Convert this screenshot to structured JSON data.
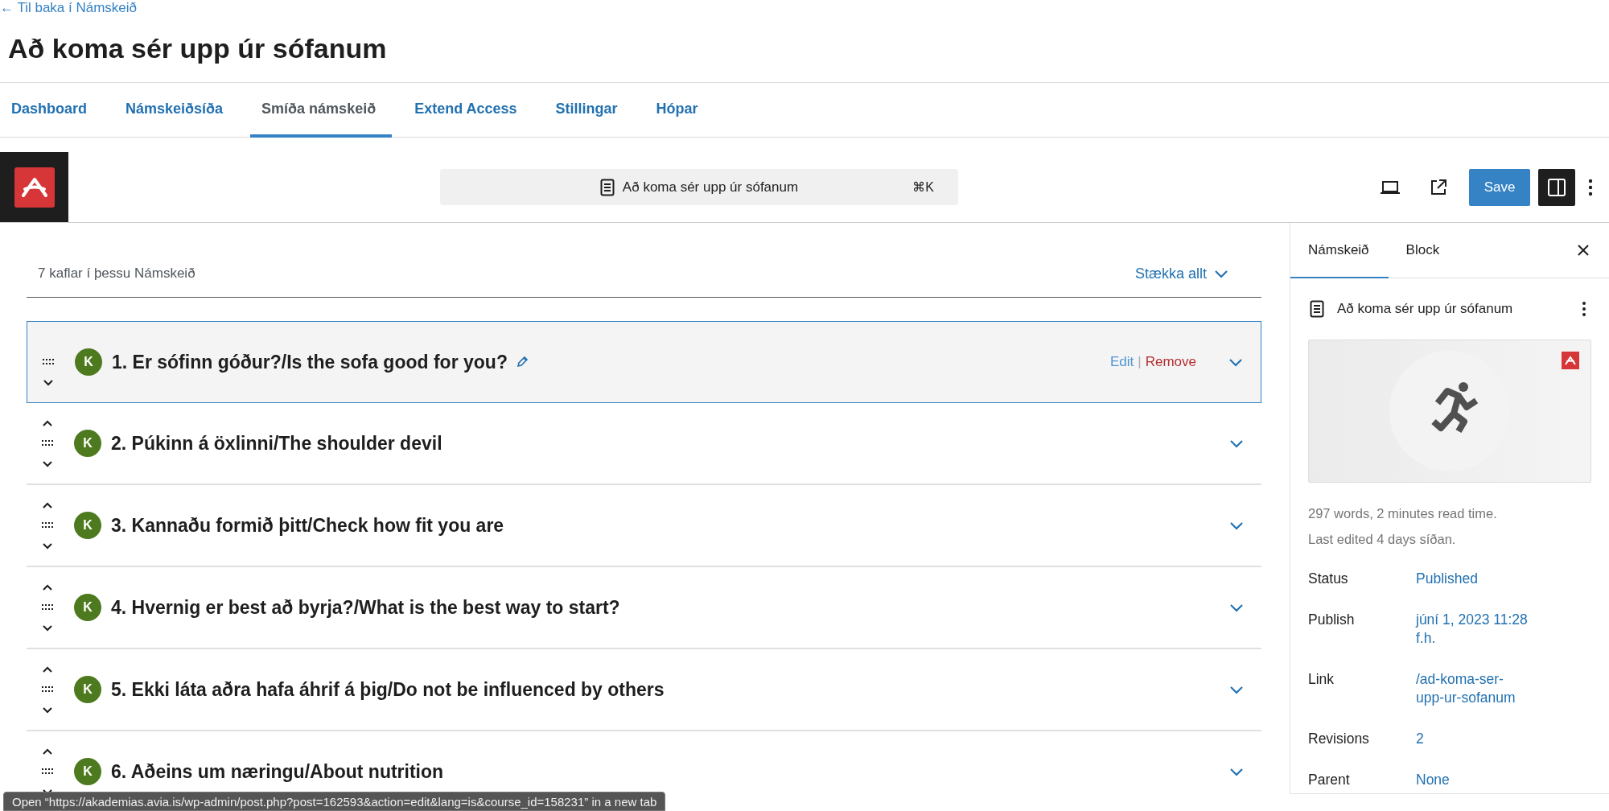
{
  "back_link": "← Til baka í Námskeið",
  "page_title": "Að koma sér upp úr sófanum",
  "tabs": [
    {
      "label": "Dashboard",
      "selected": false
    },
    {
      "label": "Námskeiðsíða",
      "selected": false
    },
    {
      "label": "Smíða námskeið",
      "selected": true
    },
    {
      "label": "Extend Access",
      "selected": false
    },
    {
      "label": "Stillingar",
      "selected": false
    },
    {
      "label": "Hópar",
      "selected": false
    }
  ],
  "toolbar": {
    "document_title": "Að koma sér upp úr sófanum",
    "shortcut": "⌘K",
    "save_label": "Save",
    "sidebar_open": true
  },
  "lessons": {
    "count_label": "7 kaflar í þessu Námskeið",
    "expand_all": "Stækka allt",
    "items": [
      {
        "avatar": "K",
        "title": "1. Er sófinn góður?/Is the sofa good for you?",
        "selected": true,
        "can_move_up": false,
        "separator": "|",
        "actions": [
          {
            "kind": "edit",
            "label": "Edit"
          },
          {
            "kind": "remove",
            "label": "Remove"
          }
        ]
      },
      {
        "avatar": "K",
        "title": "2. Púkinn á öxlinni/The shoulder devil",
        "selected": false,
        "can_move_up": true
      },
      {
        "avatar": "K",
        "title": "3. Kannaðu formið þitt/Check how fit you are",
        "selected": false,
        "can_move_up": true
      },
      {
        "avatar": "K",
        "title": "4. Hvernig er best að byrja?/What is the best way to start?",
        "selected": false,
        "can_move_up": true
      },
      {
        "avatar": "K",
        "title": "5. Ekki láta aðra hafa áhrif á þig/Do not be influenced by others",
        "selected": false,
        "can_move_up": true
      },
      {
        "avatar": "K",
        "title": "6. Aðeins um næringu/About nutrition",
        "selected": false,
        "can_move_up": true
      }
    ]
  },
  "sidebar": {
    "tabs": [
      {
        "label": "Námskeið",
        "selected": true
      },
      {
        "label": "Block",
        "selected": false
      }
    ],
    "post_title": "Að koma sér upp úr sófanum",
    "stats": [
      "297 words, 2 minutes read time.",
      "Last edited 4 days síðan."
    ],
    "fields": [
      {
        "label": "Status",
        "value": "Published"
      },
      {
        "label": "Publish",
        "value": "júní 1, 2023 11:28 f.h."
      },
      {
        "label": "Link",
        "value": "/ad-koma-ser-upp-ur-sofanum"
      },
      {
        "label": "Revisions",
        "value": "2"
      },
      {
        "label": "Parent",
        "value": "None"
      }
    ]
  },
  "status_tooltip": "Open “https://akademias.avia.is/wp-admin/post.php?post=162593&action=edit&lang=is&course_id=158231” in a new tab"
}
